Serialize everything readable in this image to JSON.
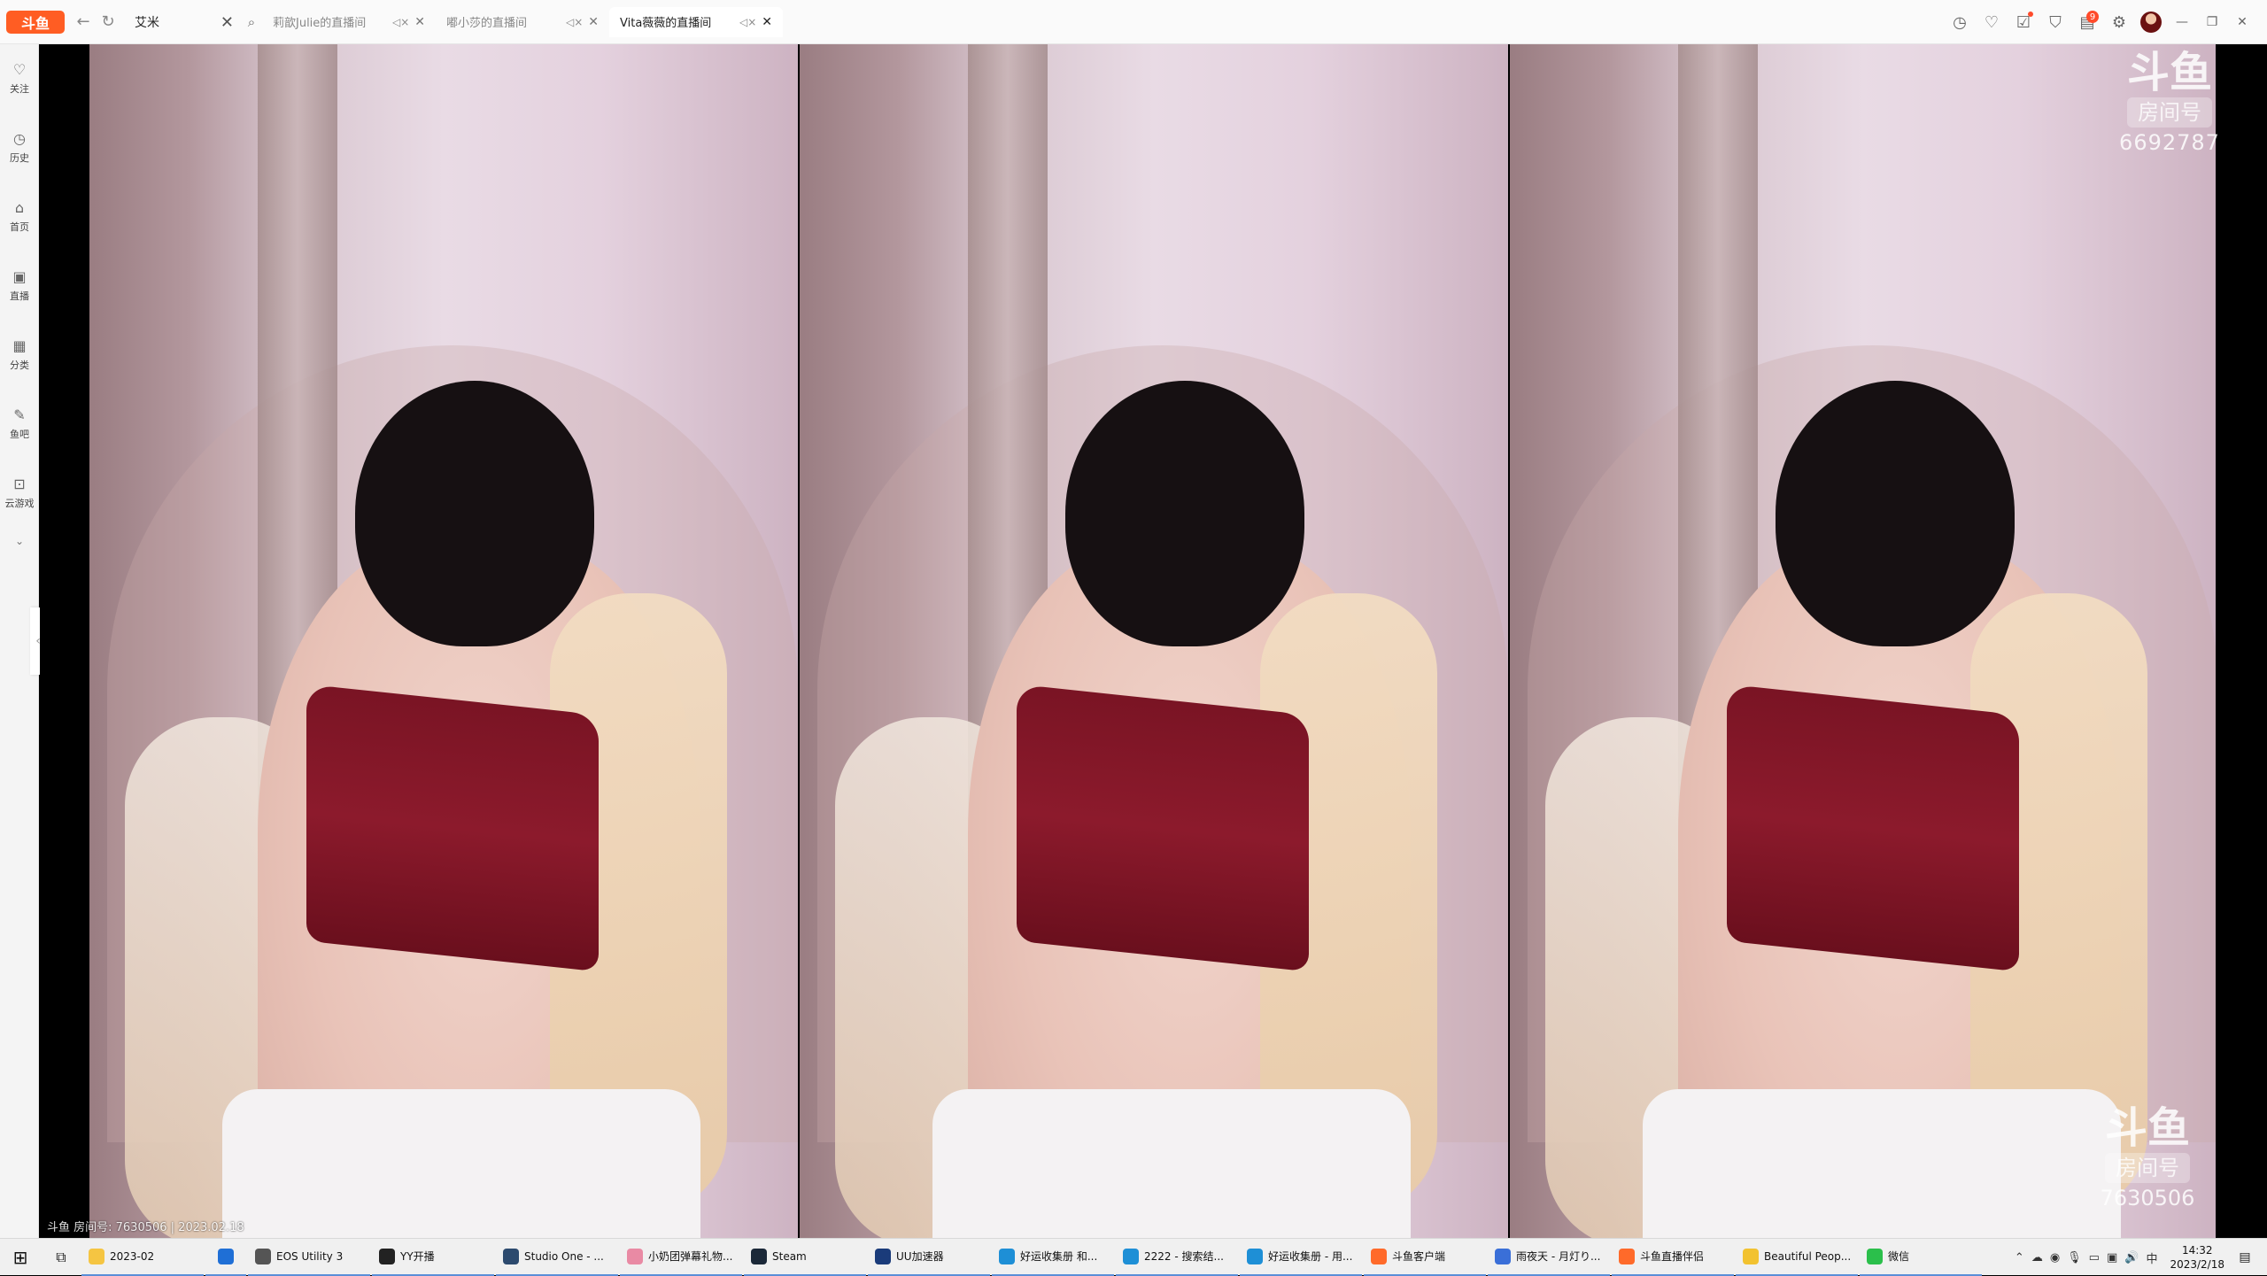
{
  "window": {
    "logo": "斗鱼",
    "search_value": "艾米",
    "tabs": [
      {
        "title": "莉歆Julie的直播间",
        "active": false
      },
      {
        "title": "嘟小莎的直播间",
        "active": false
      },
      {
        "title": "Vita薇薇的直播间",
        "active": true
      }
    ],
    "toolbar_badge": "9"
  },
  "sidebar": {
    "items": [
      {
        "label": "关注",
        "icon": "♡"
      },
      {
        "label": "历史",
        "icon": "◷"
      },
      {
        "label": "首页",
        "icon": "⌂"
      },
      {
        "label": "直播",
        "icon": "▣"
      },
      {
        "label": "分类",
        "icon": "▦"
      },
      {
        "label": "鱼吧",
        "icon": "✎"
      },
      {
        "label": "云游戏",
        "icon": "⊡"
      }
    ]
  },
  "video": {
    "watermark_brand": "斗鱼",
    "watermark_room_label": "房间号",
    "watermark_top_number": "6692787",
    "watermark_bottom_number": "7630506",
    "stream_info": "斗鱼 房间号: 7630506 | 2023.02.18"
  },
  "taskbar": {
    "items": [
      {
        "label": "2023-02",
        "color": "#f5c542"
      },
      {
        "label": "",
        "color": "#1f6fd6"
      },
      {
        "label": "EOS Utility 3",
        "color": "#555555"
      },
      {
        "label": "YY开播",
        "color": "#222222"
      },
      {
        "label": "Studio One - ...",
        "color": "#2c4a6e"
      },
      {
        "label": "小奶团弹幕礼物...",
        "color": "#e98aa4"
      },
      {
        "label": "Steam",
        "color": "#1b2838"
      },
      {
        "label": "UU加速器",
        "color": "#1a3b7a"
      },
      {
        "label": "好运收集册 和...",
        "color": "#1e8fd6"
      },
      {
        "label": "2222 - 搜索结...",
        "color": "#1e8fd6"
      },
      {
        "label": "好运收集册 - 用...",
        "color": "#1e8fd6"
      },
      {
        "label": "斗鱼客户端",
        "color": "#ff6a2a"
      },
      {
        "label": "雨夜天 - 月灯り...",
        "color": "#3a6fd8"
      },
      {
        "label": "斗鱼直播伴侣",
        "color": "#ff6a2a"
      },
      {
        "label": "Beautiful Peop...",
        "color": "#f2c230"
      },
      {
        "label": "微信",
        "color": "#2bbf4b"
      }
    ],
    "ime": "中",
    "time": "14:32",
    "date": "2023/2/18"
  }
}
